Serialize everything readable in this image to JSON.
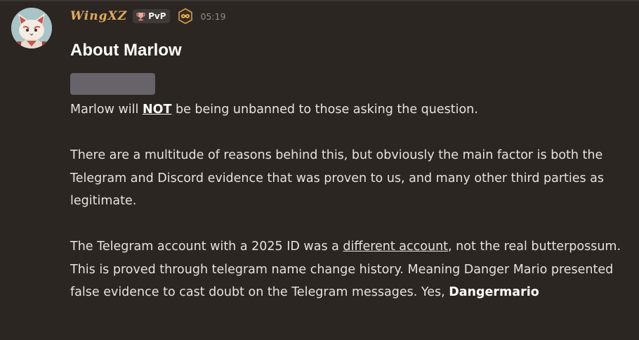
{
  "message": {
    "author": {
      "name": "WingXZ",
      "guild_tag": "PvP",
      "tag_icon": "trophy-icon",
      "role_icon": "infinity-badge-icon",
      "name_color": "#e3a960"
    },
    "timestamp": "05:19",
    "title": "About Marlow",
    "paragraphs": {
      "p1": {
        "before": "Marlow will ",
        "emphasis": "NOT",
        "after": " be being unbanned to those asking the question."
      },
      "p2": "There are a multitude of reasons behind this, but obviously the main factor is both the Telegram and Discord evidence that was proven to us, and many other third parties as legitimate.",
      "p3": {
        "before": "The Telegram account with a 2025 ID was a ",
        "link": "different account",
        "after": ", not the real butterpossum. This is proved through telegram name change history. Meaning Danger Mario presented false evidence to cast doubt on the Telegram messages. Yes, ",
        "bold": "Dangermario"
      }
    }
  }
}
